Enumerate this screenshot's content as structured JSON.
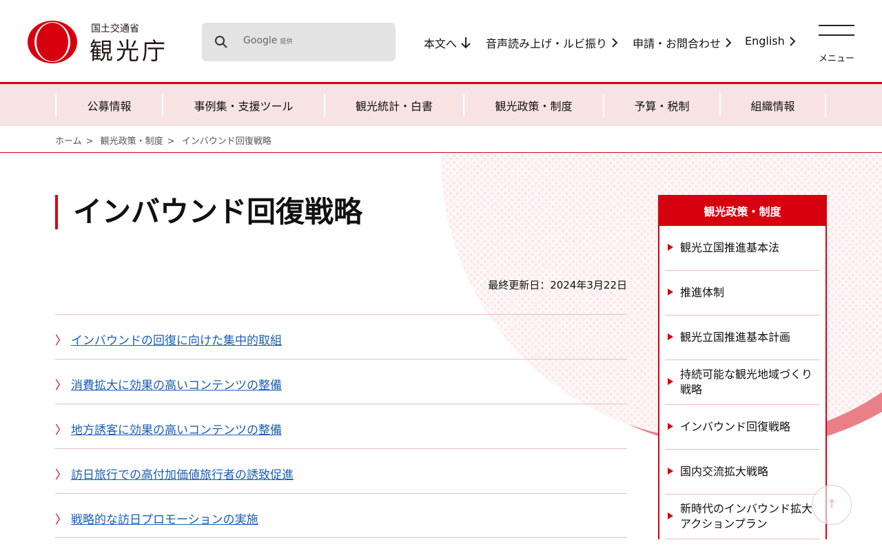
{
  "header": {
    "logo_ministry": "国土交通省",
    "logo_agency": "観光庁",
    "search_placeholder": "Google",
    "search_provided": "提供",
    "utility": [
      {
        "label": "本文へ",
        "icon": "arrow-down-icon"
      },
      {
        "label": "音声読み上げ・ルビ振り",
        "icon": "chevron-right-icon"
      },
      {
        "label": "申請・お問合わせ",
        "icon": "chevron-right-icon"
      },
      {
        "label": "English",
        "icon": "chevron-right-icon"
      }
    ],
    "menu_label": "メニュー"
  },
  "gnav": [
    "公募情報",
    "事例集・支援ツール",
    "観光統計・白書",
    "観光政策・制度",
    "予算・税制",
    "組織情報"
  ],
  "breadcrumb": [
    "ホーム",
    "観光政策・制度",
    "インバウンド回復戦略"
  ],
  "breadcrumb_sep": ">",
  "page": {
    "title": "インバウンド回復戦略",
    "updated": "最終更新日：2024年3月22日",
    "links": [
      "インバウンドの回復に向けた集中的取組",
      "消費拡大に効果の高いコンテンツの整備",
      "地方誘客に効果の高いコンテンツの整備",
      "訪日旅行での高付加価値旅行者の誘致促進",
      "戦略的な訪日プロモーションの実施"
    ]
  },
  "sidebar": {
    "title": "観光政策・制度",
    "items": [
      "観光立国推進基本法",
      "推進体制",
      "観光立国推進基本計画",
      "持続可能な観光地域づくり戦略",
      "インバウンド回復戦略",
      "国内交流拡大戦略",
      "新時代のインバウンド拡大アクションプラン"
    ]
  },
  "colors": {
    "accent": "#d7000f",
    "nav_bg": "#f8e3e4",
    "link": "#1a5fb4"
  },
  "to_top_icon": "arrow-up-icon"
}
